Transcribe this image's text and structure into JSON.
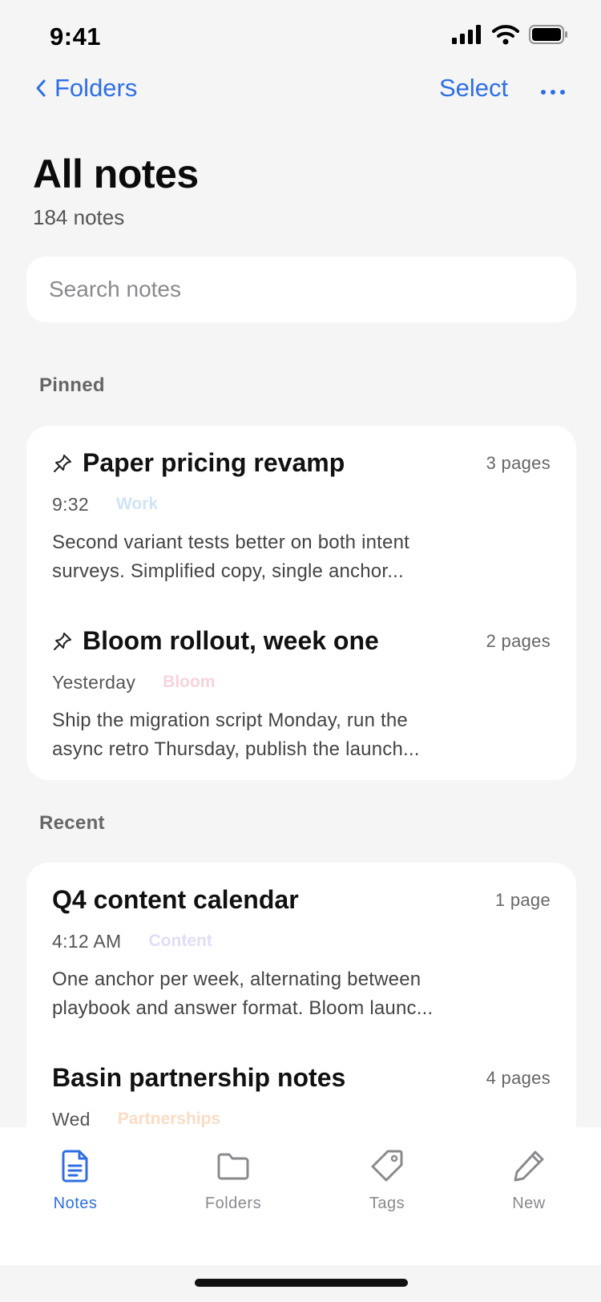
{
  "status": {
    "time": "9:41"
  },
  "nav": {
    "back_label": "Folders",
    "select_label": "Select"
  },
  "header": {
    "title": "All notes",
    "count": "184 notes"
  },
  "search": {
    "placeholder": "Search notes",
    "value": ""
  },
  "sections": {
    "pinned": "Pinned",
    "recent": "Recent"
  },
  "pinned": [
    {
      "title": "Paper pricing revamp",
      "pages": "3 pages",
      "date": "9:32",
      "tag": "Work",
      "tag_color": "#cfe4f7",
      "preview_line1": "Second variant tests better on both intent",
      "preview_line2": "surveys. Simplified copy, single anchor..."
    },
    {
      "title": "Bloom rollout, week one",
      "pages": "2 pages",
      "date": "Yesterday",
      "tag": "Bloom",
      "tag_color": "#f8d3dc",
      "preview_line1": "Ship the migration script Monday, run the",
      "preview_line2": "async retro Thursday, publish the launch..."
    }
  ],
  "recent": [
    {
      "title": "Q4 content calendar",
      "pages": "1 page",
      "date": "4:12 AM",
      "tag": "Content",
      "tag_color": "#e2dcf8",
      "preview_line1": "One anchor per week, alternating between",
      "preview_line2": "playbook and answer format. Bloom launc..."
    },
    {
      "title": "Basin partnership notes",
      "pages": "4 pages",
      "date": "Wed",
      "tag": "Partnerships",
      "tag_color": "#fbdcc4"
    }
  ],
  "tabs": [
    {
      "label": "Notes",
      "icon": "notes-icon",
      "active": true
    },
    {
      "label": "Folders",
      "icon": "folder-icon",
      "active": false
    },
    {
      "label": "Tags",
      "icon": "tag-icon",
      "active": false
    },
    {
      "label": "New",
      "icon": "pencil-icon",
      "active": false
    }
  ],
  "colors": {
    "accent": "#2f6fe4",
    "inactive": "#8a8a8e",
    "background": "#f5f5f6"
  }
}
